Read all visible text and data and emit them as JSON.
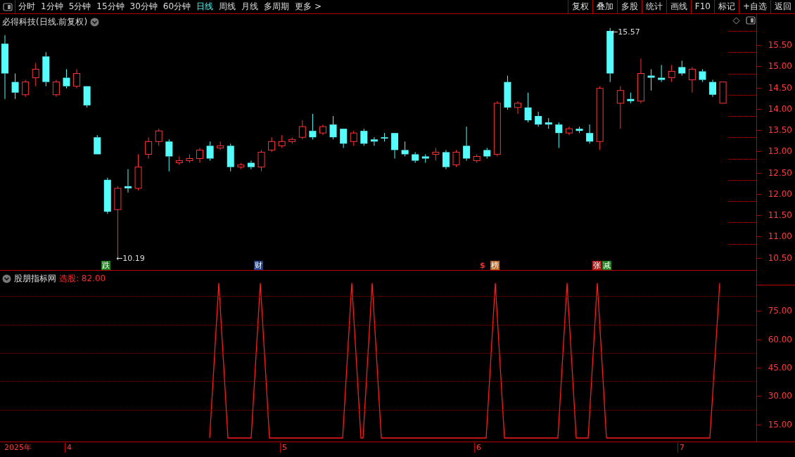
{
  "toolbar": {
    "periods": [
      {
        "label": "分时",
        "selected": false
      },
      {
        "label": "1分钟",
        "selected": false
      },
      {
        "label": "5分钟",
        "selected": false
      },
      {
        "label": "15分钟",
        "selected": false
      },
      {
        "label": "30分钟",
        "selected": false
      },
      {
        "label": "60分钟",
        "selected": false
      },
      {
        "label": "日线",
        "selected": true
      },
      {
        "label": "周线",
        "selected": false
      },
      {
        "label": "月线",
        "selected": false
      },
      {
        "label": "多周期",
        "selected": false
      },
      {
        "label": "更多 >",
        "selected": false
      }
    ],
    "buttons": [
      "复权",
      "叠加",
      "多股",
      "统计",
      "画线",
      "F10",
      "标记",
      "+自选",
      "返回"
    ]
  },
  "main_chart": {
    "title": "必得科技(日线.前复权)",
    "high_label": "←15.57",
    "low_label": "←10.19",
    "price_ticks": [
      "15.50",
      "15.00",
      "14.50",
      "14.00",
      "13.50",
      "13.00",
      "12.50",
      "12.00",
      "11.50",
      "11.00",
      "10.50"
    ],
    "signals": [
      {
        "text": "跌",
        "kind": "tag",
        "color": "#1a7f1a"
      },
      {
        "text": "财",
        "kind": "tag",
        "color": "#1c3f8c"
      },
      {
        "text": "$",
        "kind": "glyph",
        "color": "#ff2a2a"
      },
      {
        "text": "榜",
        "kind": "tag",
        "color": "#c0641c"
      },
      {
        "text": "张",
        "kind": "tag",
        "color": "#b01c1c"
      },
      {
        "text": "减",
        "kind": "tag",
        "color": "#1a7f1a"
      }
    ]
  },
  "indicator": {
    "name": "股朋指标网",
    "reading": "选股: 82.00",
    "ticks": [
      "75.00",
      "60.00",
      "45.00",
      "30.00",
      "15.00"
    ]
  },
  "time_axis": {
    "year": "2025年",
    "months": [
      "4",
      "5",
      "6",
      "7"
    ]
  }
}
